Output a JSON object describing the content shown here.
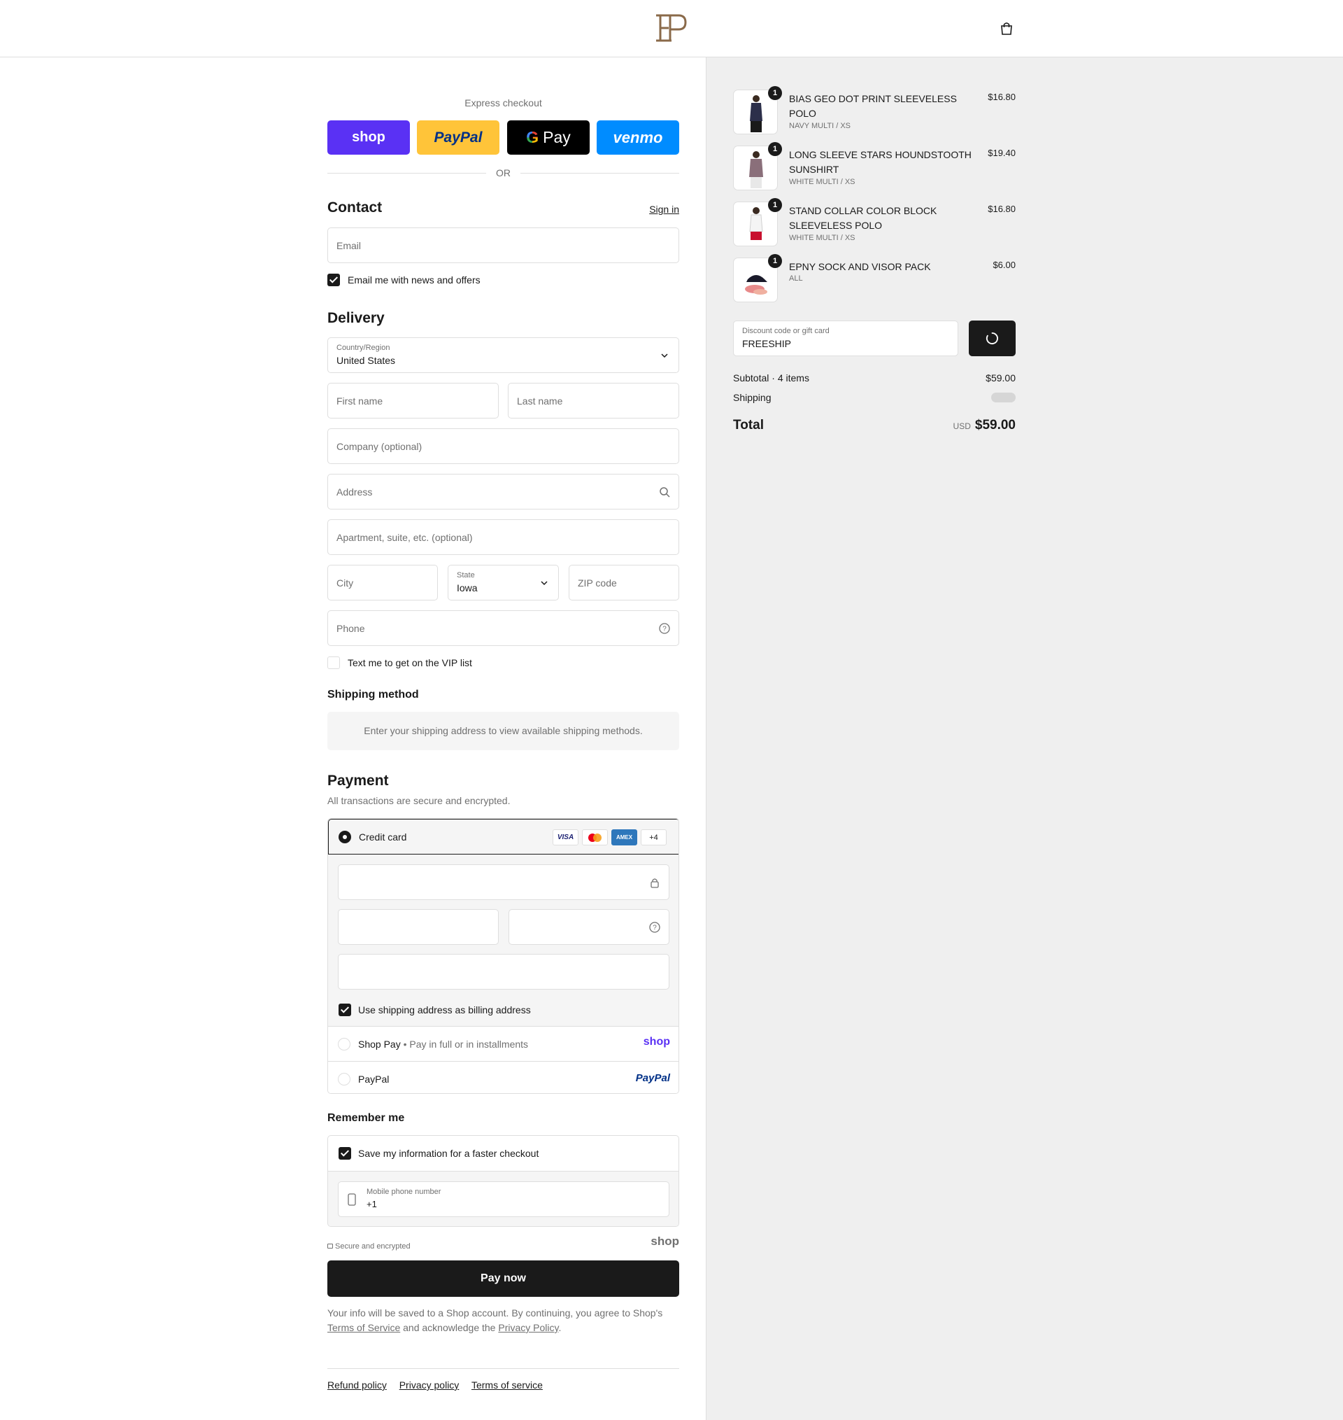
{
  "header": {
    "logo_alt": "EP",
    "bag_icon": "shopping-bag-icon"
  },
  "express": {
    "title": "Express checkout",
    "buttons": [
      {
        "label": "shop",
        "color": "#5a31f4",
        "text_color": "#ffffff"
      },
      {
        "label": "PayPal",
        "color": "#ffc439",
        "text_color": "#003087"
      },
      {
        "label": "Pay",
        "color": "#000000",
        "text_color": "#ffffff"
      },
      {
        "label": "venmo",
        "color": "#008cff",
        "text_color": "#ffffff"
      }
    ],
    "or_label": "OR"
  },
  "contact": {
    "title": "Contact",
    "sign_in": "Sign in",
    "email_placeholder": "Email",
    "newsletter_label": "Email me with news and offers",
    "newsletter_checked": true
  },
  "delivery": {
    "title": "Delivery",
    "country_label": "Country/Region",
    "country_value": "United States",
    "first_name": "First name",
    "last_name": "Last name",
    "company": "Company (optional)",
    "address": "Address",
    "apartment": "Apartment, suite, etc. (optional)",
    "city": "City",
    "state_label": "State",
    "state_value": "Iowa",
    "zip": "ZIP code",
    "phone": "Phone",
    "vip_label": "Text me to get on the VIP list",
    "vip_checked": false
  },
  "shipping_method": {
    "title": "Shipping method",
    "info": "Enter your shipping address to view available shipping methods."
  },
  "payment": {
    "title": "Payment",
    "subtitle": "All transactions are secure and encrypted.",
    "credit_card_label": "Credit card",
    "card_badges": [
      "VISA",
      "MC",
      "AMEX",
      "+4"
    ],
    "billing_label": "Use shipping address as billing address",
    "billing_checked": true,
    "shop_pay_label": "Shop Pay",
    "shop_pay_desc": "Pay in full or in installments",
    "shop_pay_logo": "shop",
    "paypal_label": "PayPal",
    "paypal_logo": "PayPal"
  },
  "remember": {
    "title": "Remember me",
    "save_label": "Save my information for a faster checkout",
    "save_checked": true,
    "mobile_label": "Mobile phone number",
    "mobile_value": "+1",
    "secure_label": "Secure and encrypted",
    "shop_logo": "shop"
  },
  "pay_now": "Pay now",
  "legal": {
    "part1": "Your info will be saved to a Shop account. By continuing, you agree to Shop's ",
    "terms": "Terms of Service",
    "part2": " and acknowledge the ",
    "privacy": "Privacy Policy",
    "part3": "."
  },
  "footer": {
    "links": [
      "Refund policy",
      "Privacy policy",
      "Terms of service"
    ]
  },
  "summary": {
    "items": [
      {
        "name": "BIAS GEO DOT PRINT SLEEVELESS POLO",
        "variant": "NAVY MULTI / XS",
        "price": "$16.80",
        "qty": "1"
      },
      {
        "name": "LONG SLEEVE STARS HOUNDSTOOTH SUNSHIRT",
        "variant": "WHITE MULTI / XS",
        "price": "$19.40",
        "qty": "1"
      },
      {
        "name": "STAND COLLAR COLOR BLOCK SLEEVELESS POLO",
        "variant": "WHITE MULTI / XS",
        "price": "$16.80",
        "qty": "1"
      },
      {
        "name": "EPNY SOCK AND VISOR PACK",
        "variant": "ALL",
        "price": "$6.00",
        "qty": "1"
      }
    ],
    "discount_label": "Discount code or gift card",
    "discount_value": "FREESHIP",
    "subtotal_label": "Subtotal · 4 items",
    "subtotal_value": "$59.00",
    "shipping_label": "Shipping",
    "total_label": "Total",
    "currency": "USD",
    "total_value": "$59.00"
  }
}
